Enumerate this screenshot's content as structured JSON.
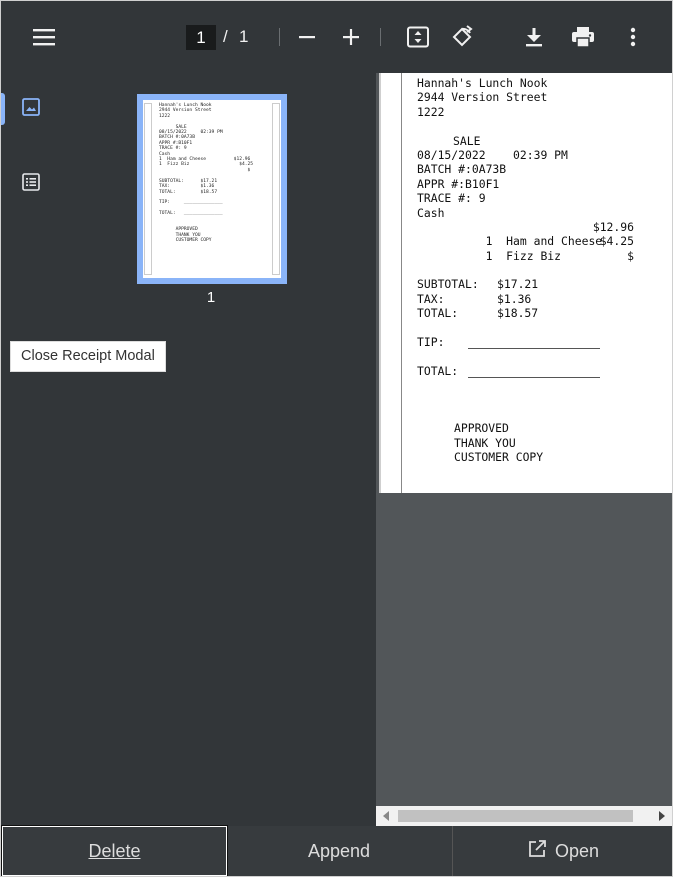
{
  "toolbar": {
    "current_page": "1",
    "separator": "/",
    "total_pages": "1"
  },
  "sidebar": {
    "thumbnail_page_number": "1"
  },
  "tooltip": "Close Receipt Modal",
  "receipt": {
    "store_name": "Hannah's Lunch Nook",
    "address": "2944 Version Street",
    "store_number": "1222",
    "transaction_type": "SALE",
    "date_time": "08/15/2022    02:39 PM",
    "batch": "BATCH #:0A73B",
    "approval": "APPR #:B10F1",
    "trace": "TRACE #: 9",
    "payment": "Cash",
    "items": [
      {
        "qty_name": "1  Ham and Cheese",
        "price": "$12.96"
      },
      {
        "qty_name": "1  Fizz Biz",
        "price": "$4.25"
      },
      {
        "qty_name": "",
        "price": "$"
      }
    ],
    "subtotal_label": "SUBTOTAL:",
    "subtotal": "$17.21",
    "tax_label": "TAX:",
    "tax": "$1.36",
    "total_label": "TOTAL:",
    "total": "$18.57",
    "tip_label": "TIP:",
    "total_line_label": "TOTAL:",
    "footer_1": "APPROVED",
    "footer_2": "THANK YOU",
    "footer_3": "CUSTOMER COPY"
  },
  "thumbnail_text": "Hannah's Lunch Nook\n2944 Version Street\n1222\n\n      SALE\n08/15/2022     02:39 PM\nBATCH #:0A73B\nAPPR #:B10F1\nTRACE #: 9\nCash\n1  Ham and Cheese          $12.96\n1  Fizz Biz                  $4.25\n                                $\n\nSUBTOTAL:      $17.21\nTAX:           $1.36\nTOTAL:         $18.57\n\nTIP:     ______________\n\nTOTAL:   ______________\n\n\n      APPROVED\n      THANK YOU\n      CUSTOMER COPY",
  "bottom_bar": {
    "delete_label": "Delete",
    "append_label": "Append",
    "open_label": "Open"
  },
  "colors": {
    "toolbar_bg": "#323639",
    "viewer_bg": "#525659",
    "accent": "#8ab4f8"
  }
}
